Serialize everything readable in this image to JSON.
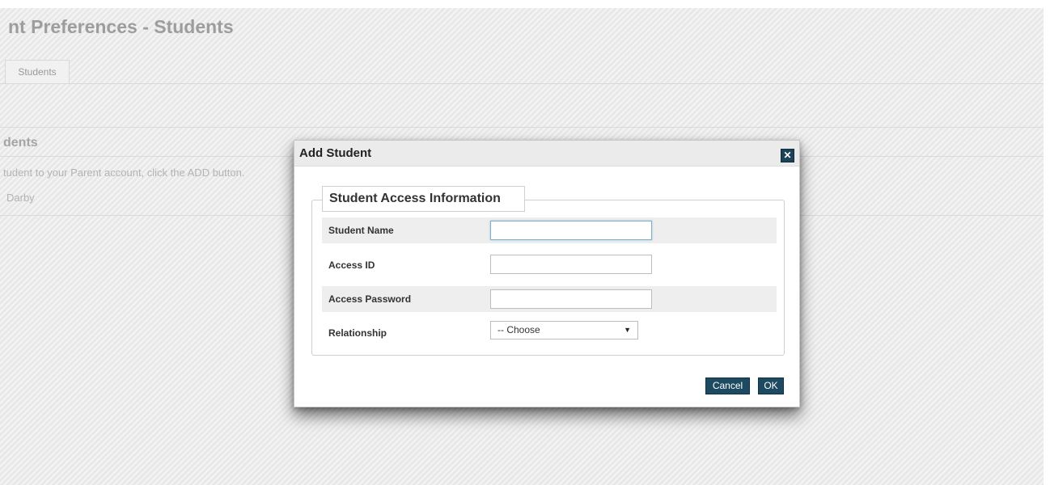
{
  "page": {
    "title": "nt Preferences - Students",
    "tab_label": "Students",
    "section_heading": "dents",
    "instruction": "tudent to your Parent account, click the ADD button.",
    "student_entry": "Darby"
  },
  "modal": {
    "title": "Add Student",
    "close_icon": "close-icon",
    "fieldset_legend": "Student Access Information",
    "fields": {
      "student_name": {
        "label": "Student Name",
        "value": ""
      },
      "access_id": {
        "label": "Access ID",
        "value": ""
      },
      "access_password": {
        "label": "Access Password",
        "value": ""
      },
      "relationship": {
        "label": "Relationship",
        "selected": "-- Choose"
      }
    },
    "cancel_label": "Cancel",
    "ok_label": "OK"
  },
  "colors": {
    "accent": "#1d4a60",
    "shaded_row": "#eeeeee",
    "background": "#ececec"
  }
}
